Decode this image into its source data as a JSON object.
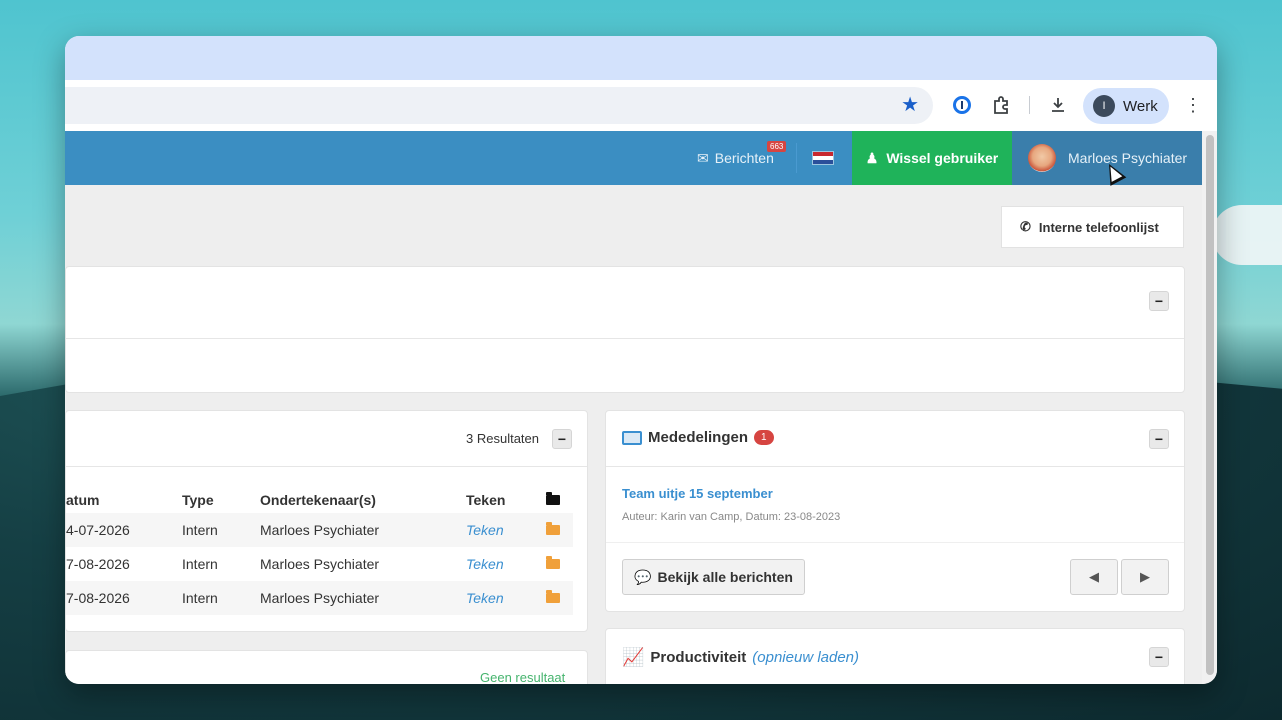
{
  "browser": {
    "profile_initial": "I",
    "profile_label": "Werk"
  },
  "header": {
    "messages_label": "Berichten",
    "messages_count": "663",
    "switch_user_label": "Wissel gebruiker",
    "user_name": "Marloes Psychiater"
  },
  "toolbar": {
    "phone_list_label": "Interne telefoonlijst"
  },
  "documents": {
    "results_label": "3 Resultaten",
    "columns": [
      "atum",
      "Type",
      "Ondertekenaar(s)",
      "Teken"
    ],
    "rows": [
      {
        "date": "4-07-2026",
        "type": "Intern",
        "signer": "Marloes Psychiater",
        "sign": "Teken"
      },
      {
        "date": "7-08-2026",
        "type": "Intern",
        "signer": "Marloes Psychiater",
        "sign": "Teken"
      },
      {
        "date": "7-08-2026",
        "type": "Intern",
        "signer": "Marloes Psychiater",
        "sign": "Teken"
      }
    ]
  },
  "second_panel": {
    "status": "Geen resultaat"
  },
  "announcements": {
    "title": "Mededelingen",
    "count": "1",
    "item_title": "Team uitje 15 september",
    "item_meta": "Auteur: Karin van Camp, Datum: 23-08-2023",
    "view_all_label": "Bekijk alle berichten"
  },
  "productivity": {
    "title": "Productiviteit",
    "reload_label": "(opnieuw laden)"
  },
  "colors": {
    "header_blue": "#3b8ec2",
    "switch_green": "#1fb35a",
    "link_blue": "#3a8fd0",
    "badge_red": "#d64541"
  }
}
